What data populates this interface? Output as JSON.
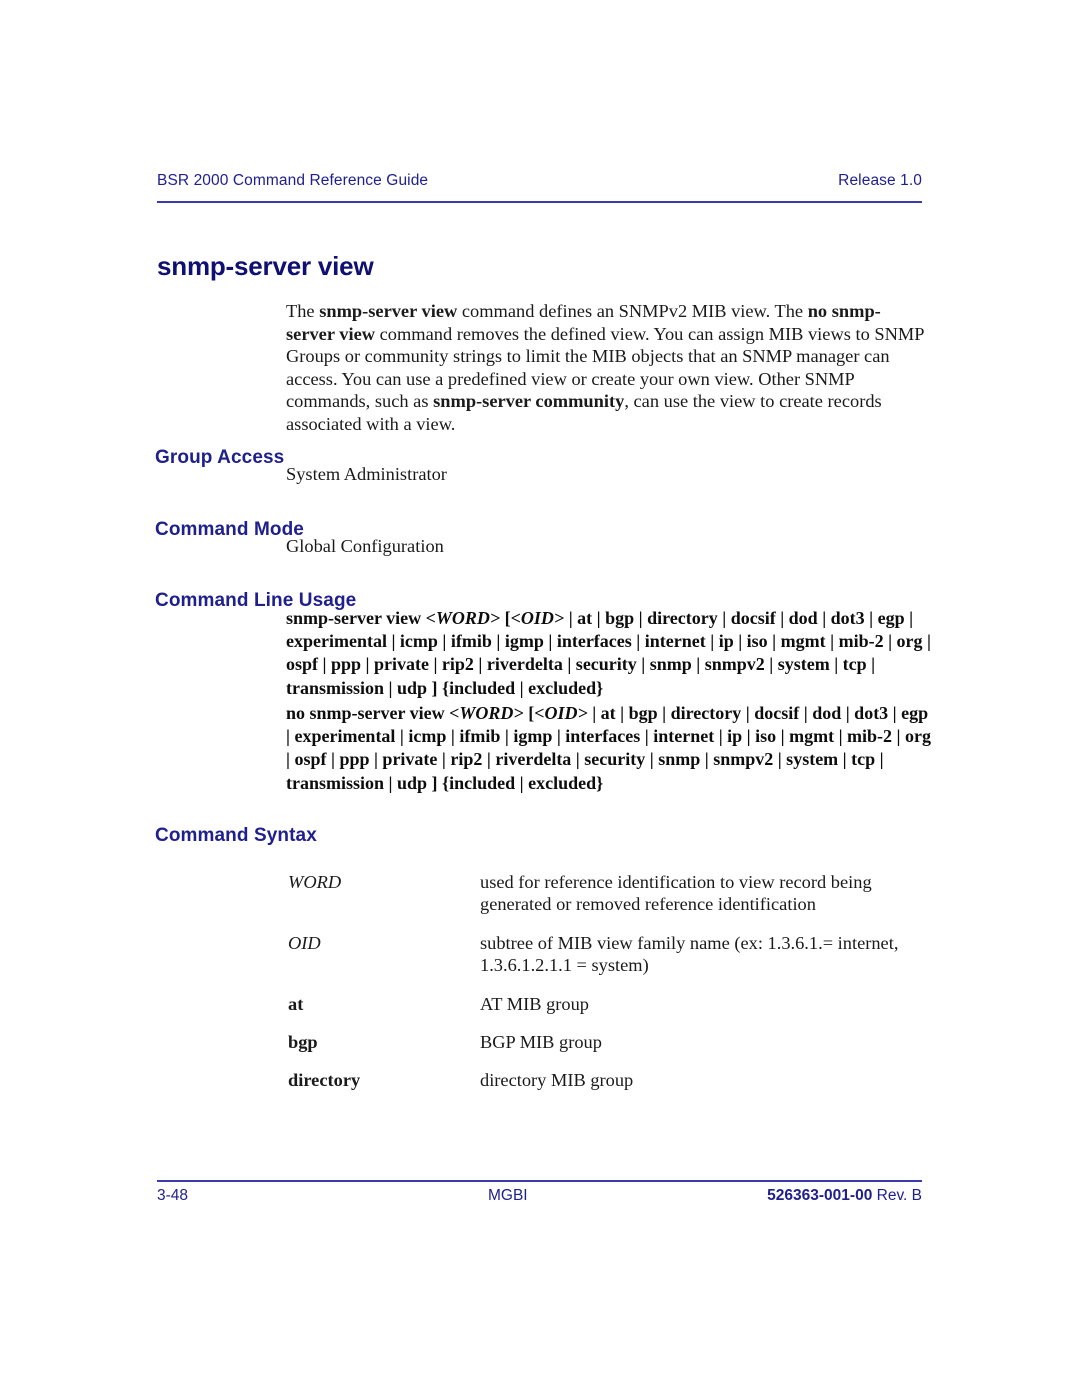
{
  "header": {
    "left": "BSR 2000 Command Reference Guide",
    "right": "Release 1.0"
  },
  "title": "snmp-server view",
  "intro": {
    "full_text": "The snmp-server view command defines an SNMPv2 MIB view. The no snmp-server view command removes the defined view. You can assign MIB views to SNMP Groups or community strings to limit the MIB objects that an SNMP manager can access. You can use a predefined view or create your own view. Other SNMP commands, such as snmp-server community, can use the view to create records associated with a view.",
    "p1": "The ",
    "b1": "snmp-server view",
    "p2": " command defines an SNMPv2 MIB view. The ",
    "b2": "no",
    "p3": " ",
    "b3": "snmp-server view",
    "p4": " command removes the defined view. You can assign MIB views to SNMP Groups or community strings to limit the MIB objects that an SNMP manager can access. You can use a predefined view or create your own view. Other SNMP commands, such as ",
    "b4": "snmp-server community",
    "p5": ", can use the view to create records associated with a view."
  },
  "sections": {
    "group_access": {
      "heading": "Group Access",
      "value": "System Administrator"
    },
    "command_mode": {
      "heading": "Command Mode",
      "value": "Global Configuration"
    },
    "command_line_usage": {
      "heading": "Command Line Usage",
      "positive": {
        "prefix": "snmp-server view ",
        "word": "<WORD>",
        "mid": " [",
        "oid": "<OID>",
        "rest": " | at | bgp | directory | docsif | dod | dot3 | egp | experimental | icmp | ifmib | igmp | interfaces | internet | ip | iso | mgmt | mib-2 | org | ospf | ppp | private | rip2 | riverdelta | security | snmp | snmpv2 | system | tcp | transmission | udp ] {included | excluded}",
        "full_text": "snmp-server view <WORD> [<OID> | at | bgp | directory | docsif | dod | dot3 | egp | experimental | icmp | ifmib | igmp | interfaces | internet | ip | iso | mgmt | mib-2 | org | ospf | ppp | private | rip2 | riverdelta | security | snmp | snmpv2 | system | tcp | transmission | udp ] {included | excluded}"
      },
      "negative": {
        "prefix": "no snmp-server view ",
        "word": "<WORD>",
        "mid": " [",
        "oid": "<OID>",
        "rest": " | at | bgp | directory | docsif | dod | dot3 | egp | experimental | icmp | ifmib | igmp | interfaces | internet | ip | iso | mgmt | mib-2 | org | ospf | ppp | private | rip2 | riverdelta | security | snmp | snmpv2 | system | tcp | transmission | udp ] {included | excluded}",
        "full_text": "no snmp-server view <WORD> [<OID> | at | bgp | directory | docsif | dod | dot3 | egp | experimental | icmp | ifmib | igmp | interfaces | internet | ip | iso | mgmt | mib-2 | org | ospf | ppp | private | rip2 | riverdelta | security | snmp | snmpv2 | system | tcp | transmission | udp ] {included | excluded}"
      }
    },
    "command_syntax": {
      "heading": "Command Syntax",
      "rows": [
        {
          "term": "WORD",
          "style": "italic",
          "desc": "used for reference identification to view record being generated or removed reference identification"
        },
        {
          "term": "OID",
          "style": "italic",
          "desc": "subtree of MIB view family name (ex: 1.3.6.1.= internet, 1.3.6.1.2.1.1 = system)"
        },
        {
          "term": "at",
          "style": "bold",
          "desc": "AT MIB group"
        },
        {
          "term": "bgp",
          "style": "bold",
          "desc": "BGP MIB group"
        },
        {
          "term": "directory",
          "style": "bold",
          "desc": "directory MIB group"
        }
      ]
    }
  },
  "footer": {
    "page_number": "3-48",
    "center": "MGBI",
    "doc_number": "526363-001-00",
    "revision": " Rev. B"
  },
  "colors": {
    "heading_blue": "#20208c",
    "title_blue": "#100f72",
    "rule_blue": "#3b3bb0",
    "body_text": "#1a1a1a"
  }
}
